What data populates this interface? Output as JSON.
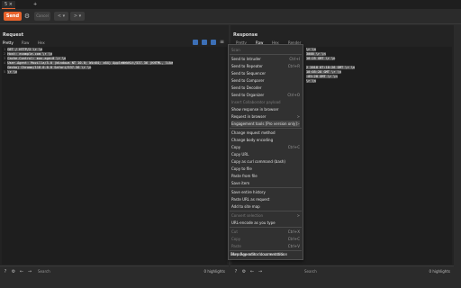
{
  "tabs": [
    {
      "label": "5 ×"
    },
    {
      "label": "+"
    }
  ],
  "toolbar": {
    "send": "Send",
    "cancel": "Cancel",
    "back": "<",
    "forward": ">"
  },
  "request": {
    "title": "Request",
    "subtabs": [
      "Pretty",
      "Raw",
      "Hex"
    ],
    "lines": [
      "GET / HTTP/2 \\r \\n",
      "Host: example.com \\r \\n",
      "Cache-Control: max-age=0 \\r \\n",
      "User-Agent: Mozilla/5.0 (Windows NT 10.0; Win64; x64) AppleWebKit/537.36 (KHTML, like",
      "Gecko) Chrome/118.0.0.0 Safari/537.36 \\r \\n",
      "\\r \\n"
    ],
    "search_placeholder": "Search",
    "highlights": "0 highlights"
  },
  "response": {
    "title": "Response",
    "subtabs": [
      "Pretty",
      "Raw",
      "Hex",
      "Render"
    ],
    "lines": [
      "\\r \\n",
      "3000 \\r \\n",
      "10:25 GMT \\r \\n",
      "",
      "2 2018 07:18:26 GMT \\r \\n",
      "10:05:28 GMT \\r \\n",
      ":05:28 GMT \\r \\n",
      "\\r \\n"
    ],
    "search_placeholder": "Search",
    "highlights": "0 highlights"
  },
  "context_menu": {
    "items": [
      {
        "label": "Scan",
        "shortcut": "",
        "disabled": true
      },
      {
        "label": "Send to Intruder",
        "shortcut": "Ctrl+I",
        "disabled": false
      },
      {
        "label": "Send to Repeater",
        "shortcut": "Ctrl+R",
        "disabled": false
      },
      {
        "label": "Send to Sequencer",
        "shortcut": "",
        "disabled": false
      },
      {
        "label": "Send to Comparer",
        "shortcut": "",
        "disabled": false
      },
      {
        "label": "Send to Decoder",
        "shortcut": "",
        "disabled": false
      },
      {
        "label": "Send to Organizer",
        "shortcut": "Ctrl+O",
        "disabled": false
      },
      {
        "label": "Insert Collaborator payload",
        "shortcut": "",
        "disabled": true
      },
      {
        "label": "Show response in browser",
        "shortcut": "",
        "disabled": false
      },
      {
        "label": "Request in browser",
        "shortcut": ">",
        "disabled": false
      },
      {
        "label": "Engagement tools [Pro version only]",
        "shortcut": ">",
        "disabled": false
      },
      {
        "label": "Change request method",
        "shortcut": "",
        "disabled": false
      },
      {
        "label": "Change body encoding",
        "shortcut": "",
        "disabled": false
      },
      {
        "label": "Copy",
        "shortcut": "Ctrl+C",
        "disabled": false
      },
      {
        "label": "Copy URL",
        "shortcut": "",
        "disabled": false
      },
      {
        "label": "Copy as curl command (bash)",
        "shortcut": "",
        "disabled": false
      },
      {
        "label": "Copy to file",
        "shortcut": "",
        "disabled": false
      },
      {
        "label": "Paste from file",
        "shortcut": "",
        "disabled": false
      },
      {
        "label": "Save item",
        "shortcut": "",
        "disabled": false
      },
      {
        "label": "Save entire history",
        "shortcut": "",
        "disabled": false
      },
      {
        "label": "Paste URL as request",
        "shortcut": "",
        "disabled": false
      },
      {
        "label": "Add to site map",
        "shortcut": "",
        "disabled": false
      },
      {
        "label": "Convert selection",
        "shortcut": ">",
        "disabled": true
      },
      {
        "label": "URL-encode as you type",
        "shortcut": "",
        "disabled": false
      },
      {
        "label": "Cut",
        "shortcut": "Ctrl+X",
        "disabled": true
      },
      {
        "label": "Copy",
        "shortcut": "Ctrl+C",
        "disabled": true
      },
      {
        "label": "Paste",
        "shortcut": "Ctrl+V",
        "disabled": true
      },
      {
        "label": "Message editor documentation",
        "shortcut": "",
        "disabled": false
      },
      {
        "label": "Burp Repeater documentation",
        "shortcut": "",
        "disabled": false
      }
    ]
  },
  "colors": {
    "accent": "#e8632b",
    "icon_blue": "#3c6fb6"
  }
}
